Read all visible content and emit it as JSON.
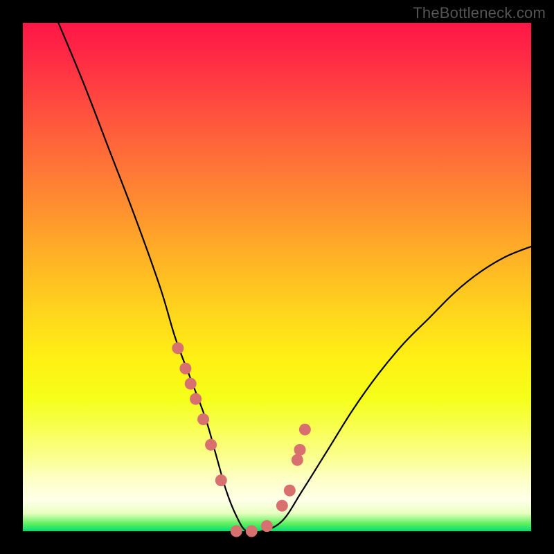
{
  "watermark": "TheBottleneck.com",
  "chart_data": {
    "type": "line",
    "title": "",
    "xlabel": "",
    "ylabel": "",
    "xlim": [
      0,
      100
    ],
    "ylim": [
      0,
      100
    ],
    "grid": false,
    "legend": false,
    "series": [
      {
        "name": "bottleneck-curve",
        "x": [
          7,
          12,
          17,
          22,
          27,
          30,
          33,
          36,
          38,
          40,
          42,
          44,
          47,
          51,
          55,
          60,
          65,
          70,
          75,
          80,
          85,
          90,
          95,
          100
        ],
        "y": [
          100,
          88,
          75,
          62,
          48,
          38,
          30,
          22,
          15,
          8,
          3,
          0,
          0,
          2,
          8,
          16,
          24,
          31,
          37,
          42,
          47,
          51,
          54,
          56
        ]
      }
    ],
    "highlight_points": {
      "name": "marked-points",
      "x": [
        30.5,
        32,
        33,
        34,
        35.5,
        37,
        39,
        42,
        45,
        48,
        51,
        52.5,
        54,
        54.5,
        55.5
      ],
      "y": [
        36,
        32,
        29,
        26,
        22,
        17,
        10,
        0,
        0,
        1,
        5,
        8,
        14,
        16,
        20
      ]
    },
    "background_gradient": {
      "top": "#ff1745",
      "mid": "#fff014",
      "bottom": "#00e070"
    }
  }
}
